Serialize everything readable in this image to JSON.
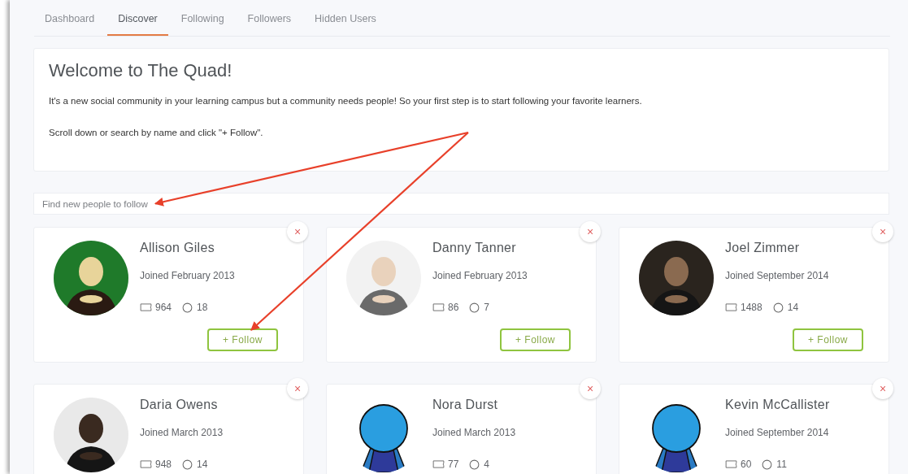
{
  "tabs": [
    {
      "label": "Dashboard",
      "selected": false
    },
    {
      "label": "Discover",
      "selected": true
    },
    {
      "label": "Following",
      "selected": false
    },
    {
      "label": "Followers",
      "selected": false
    },
    {
      "label": "Hidden Users",
      "selected": false
    }
  ],
  "welcome": {
    "title": "Welcome to The Quad!",
    "paragraphs": [
      "It's a new social community in your learning campus but a community needs people! So your first step is to start following your favorite learners.",
      "Scroll down or search by name and click \"+ Follow\"."
    ]
  },
  "search": {
    "placeholder": "Find new people to follow",
    "arrow_pointing": true
  },
  "close_label": "×",
  "people": [
    {
      "name": "Allison Giles",
      "joined": "Joined February 2013",
      "messages": "964",
      "comments": "18",
      "follow_label": "+ Follow",
      "arrow_pointing": true
    },
    {
      "name": "Danny Tanner",
      "joined": "Joined February 2013",
      "messages": "86",
      "comments": "7",
      "follow_label": "+ Follow"
    },
    {
      "name": "Joel Zimmer",
      "joined": "Joined September 2014",
      "messages": "1488",
      "comments": "14",
      "follow_label": "+ Follow"
    },
    {
      "name": "Daria Owens",
      "joined": "Joined March 2013",
      "messages": "948",
      "comments": "14"
    },
    {
      "name": "Nora Durst",
      "joined": "Joined March 2013",
      "messages": "77",
      "comments": "4",
      "avatar": {
        "kind": "default"
      }
    },
    {
      "name": "Kevin McCallister",
      "joined": "Joined September 2014",
      "messages": "60",
      "comments": "11",
      "avatar": {
        "kind": "default"
      }
    }
  ]
}
